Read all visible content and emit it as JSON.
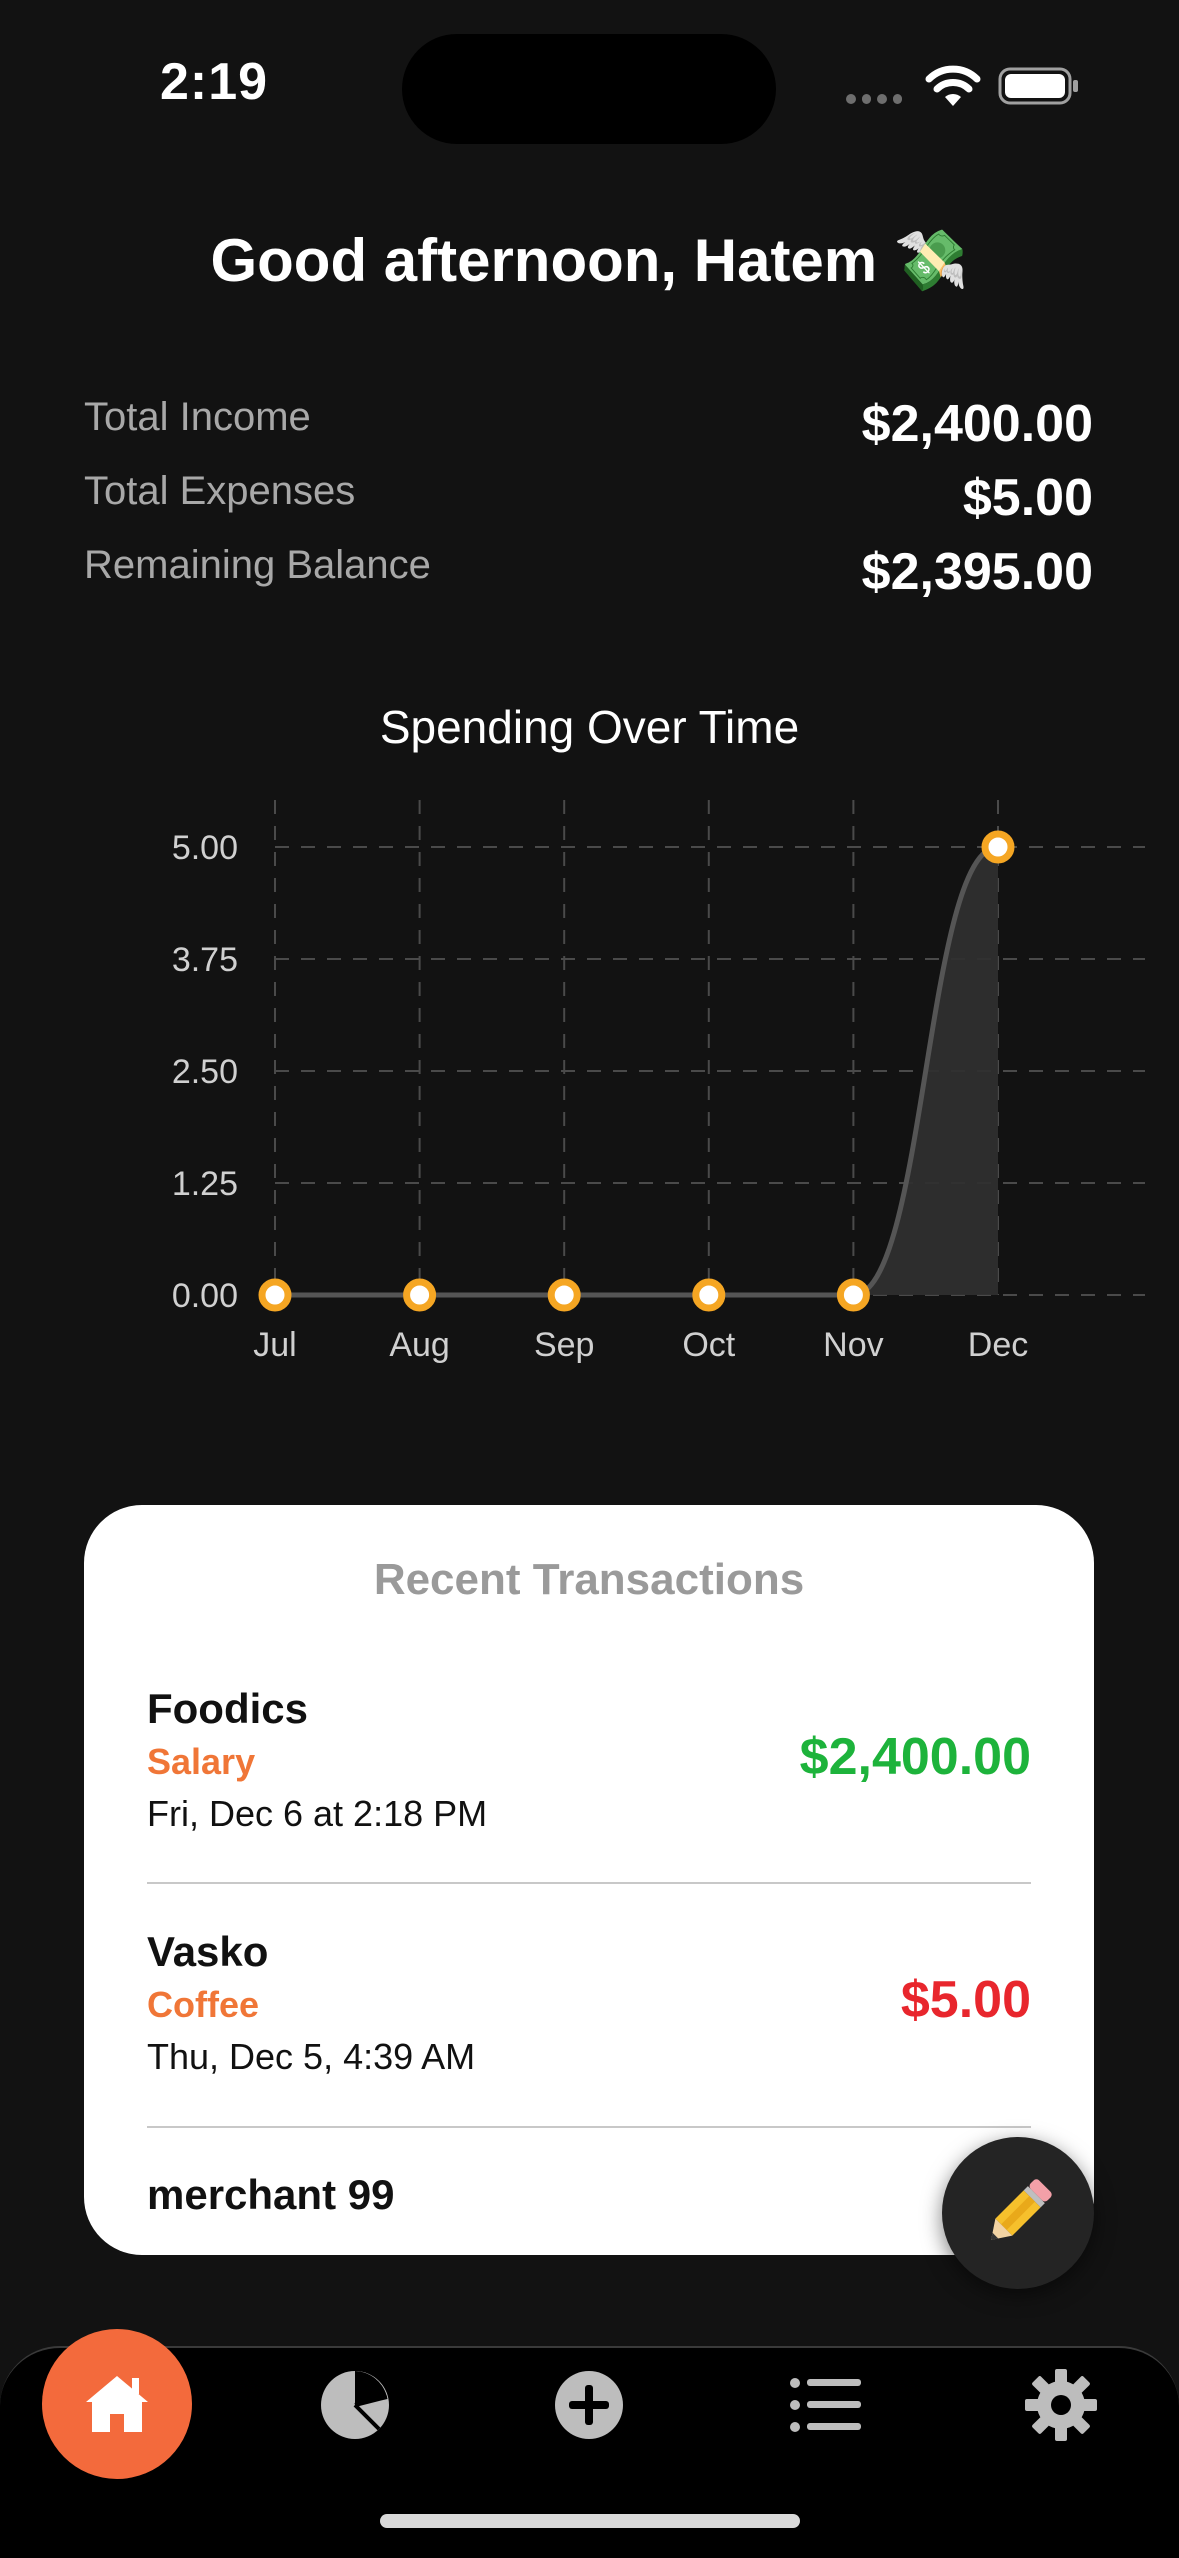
{
  "status": {
    "time": "2:19"
  },
  "greeting": "Good afternoon, Hatem 💸",
  "summary": [
    {
      "label": "Total Income",
      "value": "$2,400.00"
    },
    {
      "label": "Total Expenses",
      "value": "$5.00"
    },
    {
      "label": "Remaining Balance",
      "value": "$2,395.00"
    }
  ],
  "chart_data": {
    "type": "area",
    "title": "Spending Over Time",
    "categories": [
      "Jul",
      "Aug",
      "Sep",
      "Oct",
      "Nov",
      "Dec"
    ],
    "values": [
      0,
      0,
      0,
      0,
      0,
      5
    ],
    "yticks": [
      "0.00",
      "1.25",
      "2.50",
      "3.75",
      "5.00"
    ],
    "ylim": [
      0,
      5
    ],
    "grid": true,
    "colors": {
      "point": "#f5a623",
      "line": "#555555",
      "fill": "#2f2f2f"
    }
  },
  "transactions": {
    "title": "Recent Transactions",
    "items": [
      {
        "name": "Foodics",
        "category": "Salary",
        "date": "Fri, Dec 6 at 2:18 PM",
        "amount": "$2,400.00",
        "color": "#1db33b"
      },
      {
        "name": "Vasko",
        "category": "Coffee",
        "date": "Thu, Dec 5, 4:39 AM",
        "amount": "$5.00",
        "color": "#e8262d"
      },
      {
        "name": "merchant 99"
      }
    ]
  },
  "fab": {
    "icon": "pencil-icon"
  },
  "tabbar": {
    "accent": "#f36a3c",
    "items": [
      {
        "icon": "home-icon",
        "active": true
      },
      {
        "icon": "pie-chart-icon"
      },
      {
        "icon": "add-circle-icon"
      },
      {
        "icon": "list-icon"
      },
      {
        "icon": "gear-icon"
      }
    ]
  }
}
